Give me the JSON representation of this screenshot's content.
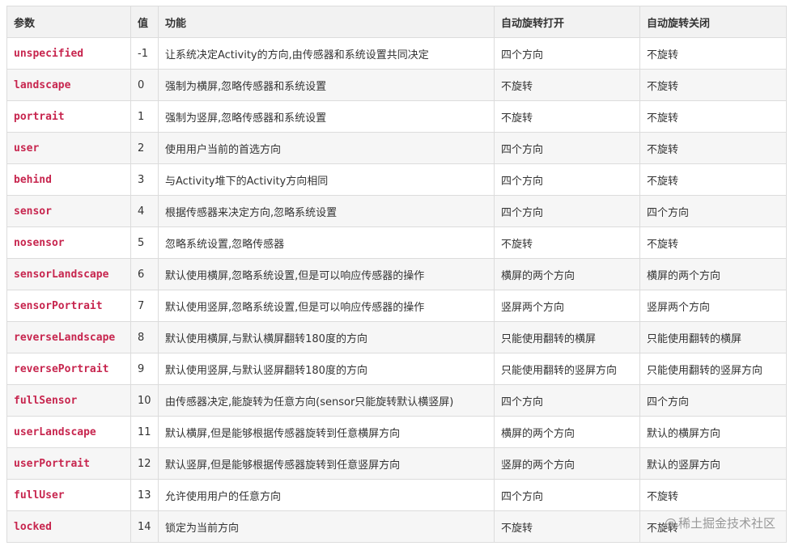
{
  "table": {
    "headers": {
      "param": "参数",
      "value": "值",
      "function": "功能",
      "auto_rotate_on": "自动旋转打开",
      "auto_rotate_off": "自动旋转关闭"
    },
    "rows": [
      {
        "param": "unspecified",
        "value": "-1",
        "function": "让系统决定Activity的方向,由传感器和系统设置共同决定",
        "on": "四个方向",
        "off": "不旋转"
      },
      {
        "param": "landscape",
        "value": "0",
        "function": "强制为横屏,忽略传感器和系统设置",
        "on": "不旋转",
        "off": "不旋转"
      },
      {
        "param": "portrait",
        "value": "1",
        "function": "强制为竖屏,忽略传感器和系统设置",
        "on": "不旋转",
        "off": "不旋转"
      },
      {
        "param": "user",
        "value": "2",
        "function": "使用用户当前的首选方向",
        "on": "四个方向",
        "off": "不旋转"
      },
      {
        "param": "behind",
        "value": "3",
        "function": "与Activity堆下的Activity方向相同",
        "on": "四个方向",
        "off": "不旋转"
      },
      {
        "param": "sensor",
        "value": "4",
        "function": "根据传感器来决定方向,忽略系统设置",
        "on": "四个方向",
        "off": "四个方向"
      },
      {
        "param": "nosensor",
        "value": "5",
        "function": "忽略系统设置,忽略传感器",
        "on": "不旋转",
        "off": "不旋转"
      },
      {
        "param": "sensorLandscape",
        "value": "6",
        "function": "默认使用横屏,忽略系统设置,但是可以响应传感器的操作",
        "on": "横屏的两个方向",
        "off": "横屏的两个方向"
      },
      {
        "param": "sensorPortrait",
        "value": "7",
        "function": "默认使用竖屏,忽略系统设置,但是可以响应传感器的操作",
        "on": "竖屏两个方向",
        "off": "竖屏两个方向"
      },
      {
        "param": "reverseLandscape",
        "value": "8",
        "function": "默认使用横屏,与默认横屏翻转180度的方向",
        "on": "只能使用翻转的横屏",
        "off": "只能使用翻转的横屏"
      },
      {
        "param": "reversePortrait",
        "value": "9",
        "function": "默认使用竖屏,与默认竖屏翻转180度的方向",
        "on": "只能使用翻转的竖屏方向",
        "off": "只能使用翻转的竖屏方向"
      },
      {
        "param": "fullSensor",
        "value": "10",
        "function": "由传感器决定,能旋转为任意方向(sensor只能旋转默认横竖屏)",
        "on": "四个方向",
        "off": "四个方向"
      },
      {
        "param": "userLandscape",
        "value": "11",
        "function": "默认横屏,但是能够根据传感器旋转到任意横屏方向",
        "on": "横屏的两个方向",
        "off": "默认的横屏方向"
      },
      {
        "param": "userPortrait",
        "value": "12",
        "function": "默认竖屏,但是能够根据传感器旋转到任意竖屏方向",
        "on": "竖屏的两个方向",
        "off": "默认的竖屏方向"
      },
      {
        "param": "fullUser",
        "value": "13",
        "function": "允许使用用户的任意方向",
        "on": "四个方向",
        "off": "不旋转"
      },
      {
        "param": "locked",
        "value": "14",
        "function": "锁定为当前方向",
        "on": "不旋转",
        "off": "不旋转"
      }
    ]
  },
  "watermark": {
    "icon": "at-icon",
    "text": "稀土掘金技术社区"
  },
  "colors": {
    "param_text": "#c7254e",
    "header_bg": "#f2f2f2",
    "stripe_bg": "#f6f6f6",
    "border": "#dcdcdc"
  }
}
